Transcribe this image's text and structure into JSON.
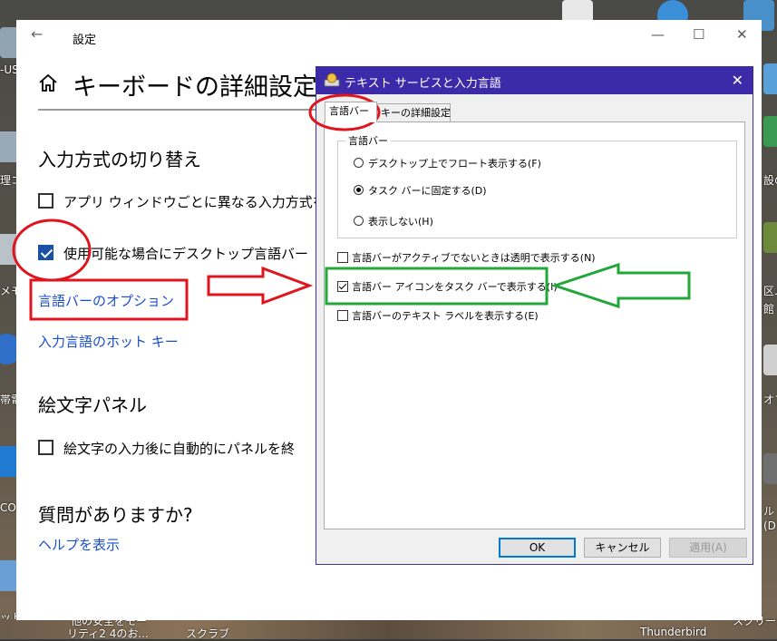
{
  "desktop": {
    "left_labels": [
      "-US",
      "理コ",
      "メモ",
      "帯電",
      "CO",
      "ットラッ"
    ],
    "right_labels": [
      "設の",
      "区ム",
      "館",
      "オフ",
      "ル",
      "(D",
      "スクリーン"
    ],
    "bottom_labels": [
      "他の安全をモー",
      "リティ2 4のお...",
      "スクラブ",
      "Thunderbird"
    ]
  },
  "settings": {
    "window_title": "設定",
    "back_icon": "←",
    "minimize_icon": "—",
    "maximize_icon": "☐",
    "close_icon": "✕",
    "page_title": "キーボードの詳細設定",
    "section_input_switch": "入力方式の切り替え",
    "checkbox_per_app": {
      "label": "アプリ ウィンドウごとに異なる入力方式を",
      "checked": false
    },
    "checkbox_desktop_langbar": {
      "label": "使用可能な場合にデスクトップ言語バー",
      "checked": true
    },
    "link_langbar_options": "言語バーのオプション",
    "link_hotkeys": "入力言語のホット キー",
    "section_emoji": "絵文字パネル",
    "checkbox_emoji": {
      "label": "絵文字の入力後に自動的にパネルを終",
      "checked": false
    },
    "section_questions": "質問がありますか?",
    "link_help": "ヘルプを表示"
  },
  "dialog": {
    "title": "テキスト サービスと入力言語",
    "close_icon": "✕",
    "tabs": [
      {
        "label": "言語バー",
        "active": true
      },
      {
        "label": "キーの詳細設定",
        "active": false
      }
    ],
    "group_label": "言語バー",
    "radios": [
      {
        "label": "デスクトップ上でフロート表示する(F)",
        "selected": false
      },
      {
        "label": "タスク バーに固定する(D)",
        "selected": true
      },
      {
        "label": "表示しない(H)",
        "selected": false
      }
    ],
    "checkboxes": [
      {
        "label": "言語バーがアクティブでないときは透明で表示する(N)",
        "checked": false
      },
      {
        "label": "言語バー アイコンをタスク バーで表示する(I)",
        "checked": true
      },
      {
        "label": "言語バーのテキスト ラベルを表示する(E)",
        "checked": false
      }
    ],
    "buttons": {
      "ok": "OK",
      "cancel": "キャンセル",
      "apply": "適用(A)"
    }
  },
  "colors": {
    "dialog_titlebar": "#3d2aa8",
    "link": "#1a4fcc",
    "annotation_red": "#e0141c",
    "annotation_green": "#22a83a"
  }
}
